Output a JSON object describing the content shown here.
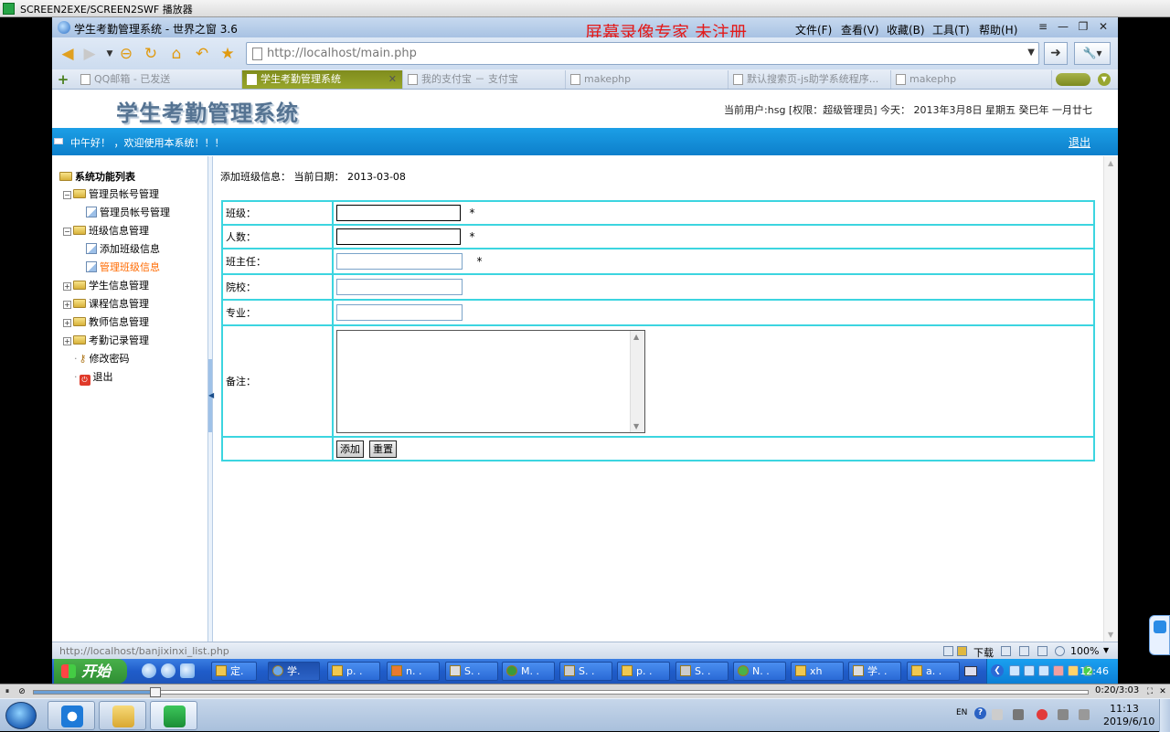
{
  "player_window": {
    "title": "SCREEN2EXE/SCREEN2SWF 播放器"
  },
  "browser": {
    "title": "学生考勤管理系统 - 世界之窗 3.6",
    "watermark": "屏幕录像专家 未注册",
    "menu": [
      "文件(F)",
      "查看(V)",
      "收藏(B)",
      "工具(T)",
      "帮助(H)"
    ],
    "address": {
      "url": "http://localhost/main.php"
    },
    "tabs": [
      {
        "label": "QQ邮箱 - 已发送",
        "active": false
      },
      {
        "label": "学生考勤管理系统",
        "active": true
      },
      {
        "label": "我的支付宝 － 支付宝",
        "active": false
      },
      {
        "label": "makephp",
        "active": false
      },
      {
        "label": "默认搜索页-js助学系统程序...",
        "active": false
      },
      {
        "label": "makephp",
        "active": false
      }
    ],
    "status_url": "http://localhost/banjixinxi_list.php",
    "download_label": "下载",
    "zoom": "100%"
  },
  "page": {
    "app_title": "学生考勤管理系统",
    "user_info": "当前用户:hsg [权限：超级管理员] 今天： 2013年3月8日 星期五 癸巳年 一月廿七",
    "greeting": "中午好！ ，欢迎使用本系统！！！",
    "logout_link": "退出",
    "tree": {
      "root": "系统功能列表",
      "nodes": [
        {
          "label": "管理员帐号管理",
          "kind": "folder",
          "expanded": true
        },
        {
          "label": "管理员帐号管理",
          "kind": "doc"
        },
        {
          "label": "班级信息管理",
          "kind": "folder",
          "expanded": true
        },
        {
          "label": "添加班级信息",
          "kind": "doc"
        },
        {
          "label": "管理班级信息",
          "kind": "doc",
          "highlight": true
        },
        {
          "label": "学生信息管理",
          "kind": "folder",
          "expanded": false
        },
        {
          "label": "课程信息管理",
          "kind": "folder",
          "expanded": false
        },
        {
          "label": "教师信息管理",
          "kind": "folder",
          "expanded": false
        },
        {
          "label": "考勤记录管理",
          "kind": "folder",
          "expanded": false
        },
        {
          "label": "修改密码",
          "kind": "key"
        },
        {
          "label": "退出",
          "kind": "exit"
        }
      ]
    },
    "breadcrumb": {
      "label": "添加班级信息：",
      "date_label": "当前日期：",
      "date": "2013-03-08"
    },
    "form": {
      "class_label": "班级：",
      "count_label": "人数：",
      "teacher_label": "班主任：",
      "college_label": "院校：",
      "major_label": "专业：",
      "remark_label": "备注：",
      "required_mark": "*",
      "class_value": "",
      "count_value": "",
      "teacher_value": "",
      "college_value": "",
      "major_value": "",
      "remark_value": "",
      "add_button": "添加",
      "reset_button": "重置"
    }
  },
  "xp_taskbar": {
    "start_label": "开始",
    "tasks": [
      "定.",
      "学.",
      "p. .",
      "n. .",
      "S. .",
      "M. .",
      "S. .",
      "p. .",
      "S. .",
      "N. .",
      "xh",
      "学. .",
      "a. ."
    ],
    "active_task_index": 1,
    "clock": "12:46"
  },
  "player": {
    "time": "0:20/3:03",
    "progress": 0.11
  },
  "host_taskbar": {
    "lang": "EN",
    "help": "?",
    "time": "11:13",
    "date": "2019/6/10"
  }
}
